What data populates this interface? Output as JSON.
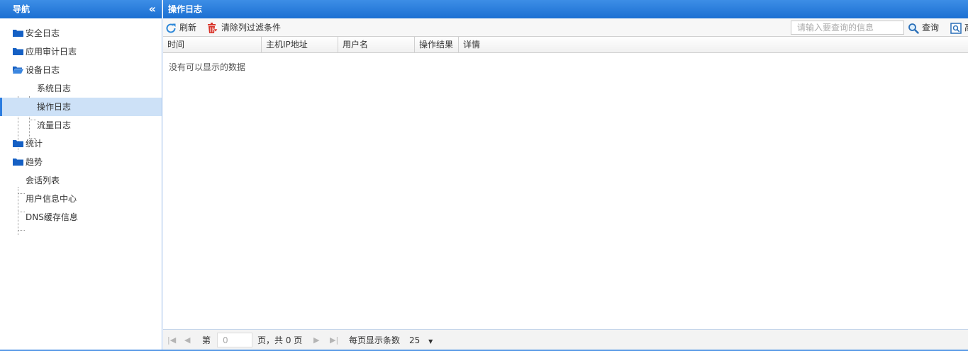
{
  "nav": {
    "title": "导航",
    "collapse_icon": "«",
    "items": [
      {
        "label": "安全日志"
      },
      {
        "label": "应用审计日志"
      },
      {
        "label": "设备日志"
      },
      {
        "label": "系统日志"
      },
      {
        "label": "操作日志"
      },
      {
        "label": "流量日志"
      },
      {
        "label": "统计"
      },
      {
        "label": "趋势"
      },
      {
        "label": "会话列表"
      },
      {
        "label": "用户信息中心"
      },
      {
        "label": "DNS缓存信息"
      }
    ]
  },
  "main": {
    "title": "操作日志",
    "toolbar": {
      "refresh_label": "刷新",
      "clear_filter_label": "清除列过滤条件",
      "search_placeholder": "请输入要查询的信息",
      "query_label": "查询",
      "advanced_label": "高"
    },
    "columns": [
      {
        "label": "时间"
      },
      {
        "label": "主机IP地址"
      },
      {
        "label": "用户名"
      },
      {
        "label": "操作结果"
      },
      {
        "label": "详情"
      }
    ],
    "empty_text": "没有可以显示的数据",
    "pager": {
      "page_prefix": "第",
      "page_value": "0",
      "page_suffix": "页，共 0 页",
      "page_size_label": "每页显示条数",
      "page_size_value": "25"
    }
  },
  "colors": {
    "header_blue": "#1b6fd2",
    "selected_bg": "#cde1f7",
    "folder_blue": "#1560c4",
    "refresh_blue": "#2a86d8",
    "delete_red": "#d9352b"
  }
}
